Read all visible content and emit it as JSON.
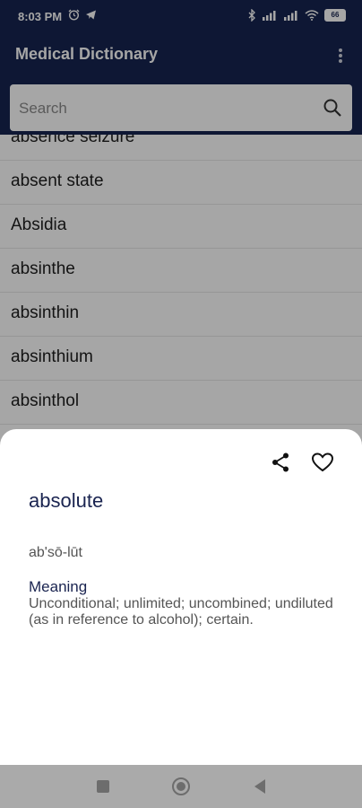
{
  "status_bar": {
    "time": "8:03 PM",
    "battery": "66"
  },
  "app_bar": {
    "title": "Medical Dictionary"
  },
  "search": {
    "placeholder": "Search"
  },
  "list": {
    "items": [
      "absence seizure",
      "absent state",
      "Absidia",
      "absinthe",
      "absinthin",
      "absinthium",
      "absinthol"
    ]
  },
  "detail": {
    "term": "absolute",
    "pronunciation": "ab'sō-lūt",
    "meaning_label": "Meaning",
    "meaning_text": "Unconditional; unlimited; uncombined; undiluted (as in reference to alcohol); certain."
  },
  "colors": {
    "primary": "#162450",
    "title_text": "#1a2450",
    "navbar": "#aaaaaa"
  },
  "icons": {
    "share": "share-icon",
    "favorite": "heart-icon",
    "search": "search-icon",
    "menu": "more-vert-icon"
  }
}
